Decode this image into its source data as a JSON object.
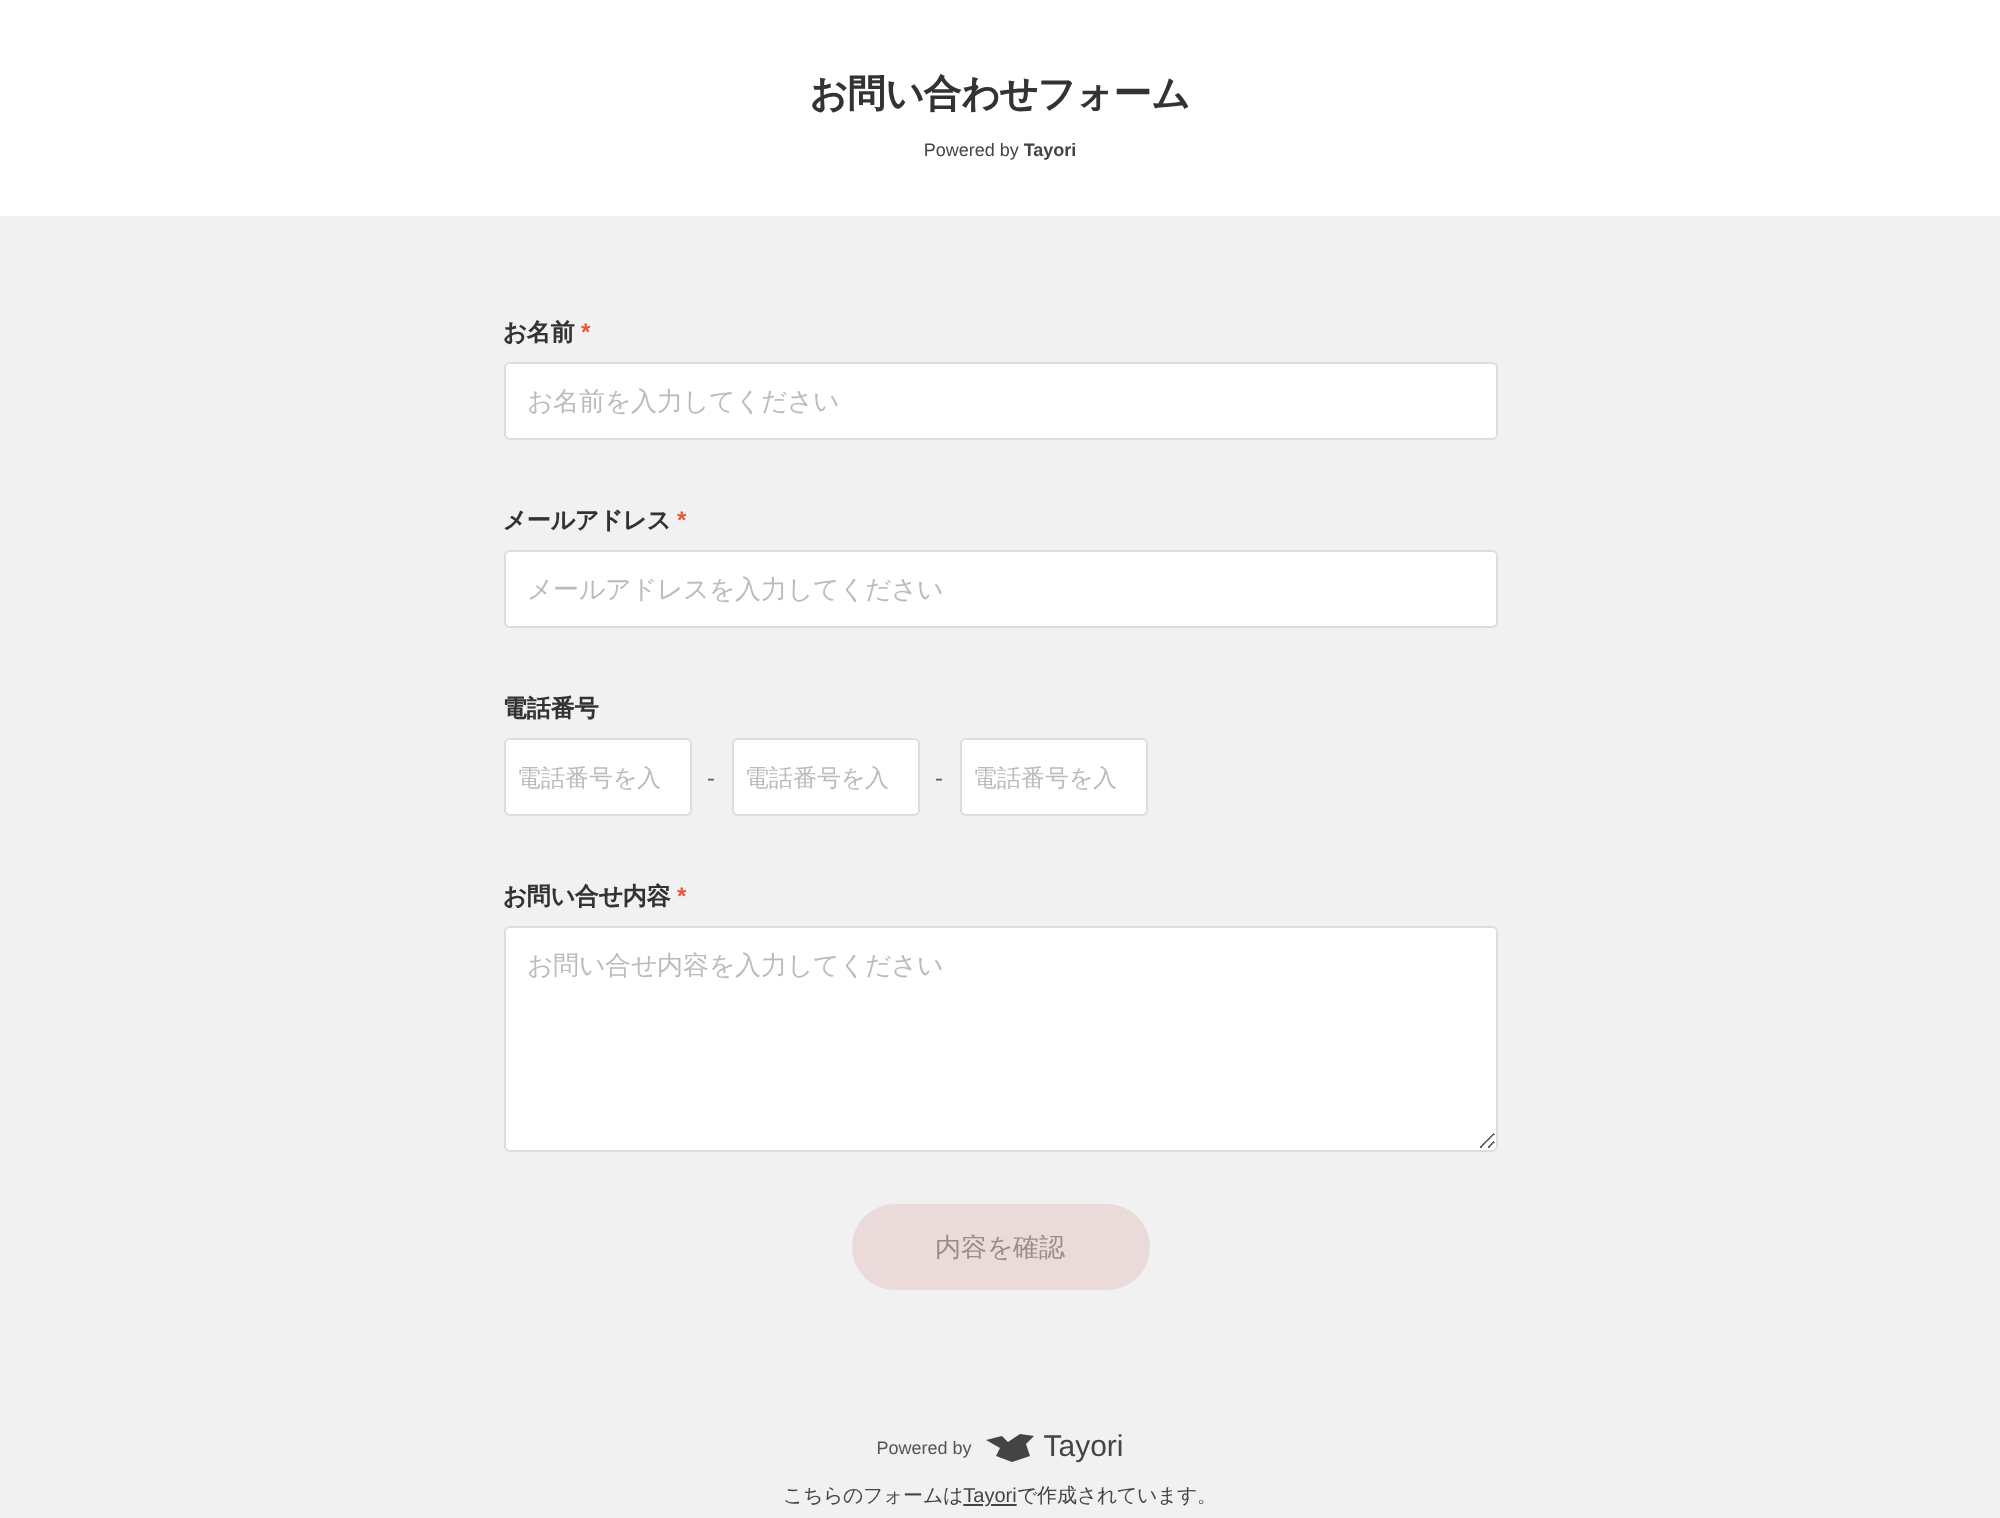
{
  "header": {
    "title": "お問い合わせフォーム",
    "powered_by": "Powered by",
    "brand": "Tayori"
  },
  "fields": [
    {
      "kind": "text",
      "label": "お名前",
      "required_mark": "*",
      "placeholders": [
        "お名前を入力してください"
      ]
    },
    {
      "kind": "text",
      "label": "メールアドレス",
      "required_mark": "*",
      "placeholders": [
        "メールアドレスを入力してください"
      ]
    },
    {
      "kind": "phone",
      "label": "電話番号",
      "separator": "-",
      "placeholders": [
        "電話番号を入",
        "電話番号を入",
        "電話番号を入"
      ]
    },
    {
      "kind": "textarea",
      "label": "お問い合せ内容",
      "required_mark": "*",
      "placeholders": [
        "お問い合せ内容を入力してください"
      ]
    }
  ],
  "submit": {
    "label": "内容を確認",
    "disabled": true
  },
  "footer": {
    "powered_by": "Powered by",
    "brand": "Tayori",
    "note_before": "こちらのフォームは",
    "link": "Tayori",
    "note_after": "で作成されています。"
  }
}
